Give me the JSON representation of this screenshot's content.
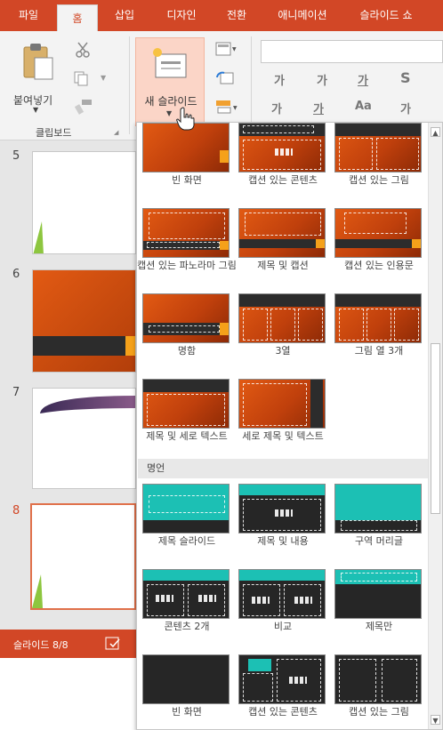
{
  "tabs": [
    "파일",
    "홈",
    "삽입",
    "디자인",
    "전환",
    "애니메이션",
    "슬라이드 쇼"
  ],
  "ribbon": {
    "paste_label": "붙여넣기",
    "clipboard_group_label": "클립보드",
    "new_slide_label": "새 슬라이드",
    "format_buttons": [
      "가",
      "가",
      "가",
      "S",
      "가",
      "가",
      "Aa",
      "가"
    ]
  },
  "slides": [
    {
      "number": "5"
    },
    {
      "number": "6"
    },
    {
      "number": "7"
    },
    {
      "number": "8"
    }
  ],
  "status": {
    "slide_counter": "슬라이드 8/8"
  },
  "gallery": {
    "section_2_label": "명언",
    "orange_layouts": [
      "빈 화면",
      "캡션 있는 콘텐츠",
      "캡션 있는 그림",
      "캡션 있는 파노라마 그림",
      "제목 및 캡션",
      "캡션 있는 인용문",
      "명함",
      "3열",
      "그림 열 3개",
      "제목 및 세로 텍스트",
      "세로 제목 및 텍스트"
    ],
    "teal_layouts": [
      "제목 슬라이드",
      "제목 및 내용",
      "구역 머리글",
      "콘텐츠 2개",
      "비교",
      "제목만",
      "빈 화면",
      "캡션 있는 콘텐츠",
      "캡션 있는 그림"
    ]
  },
  "colors": {
    "accent": "#d24726",
    "orange_theme": "#e25a13",
    "teal_theme": "#1cc0b4"
  }
}
